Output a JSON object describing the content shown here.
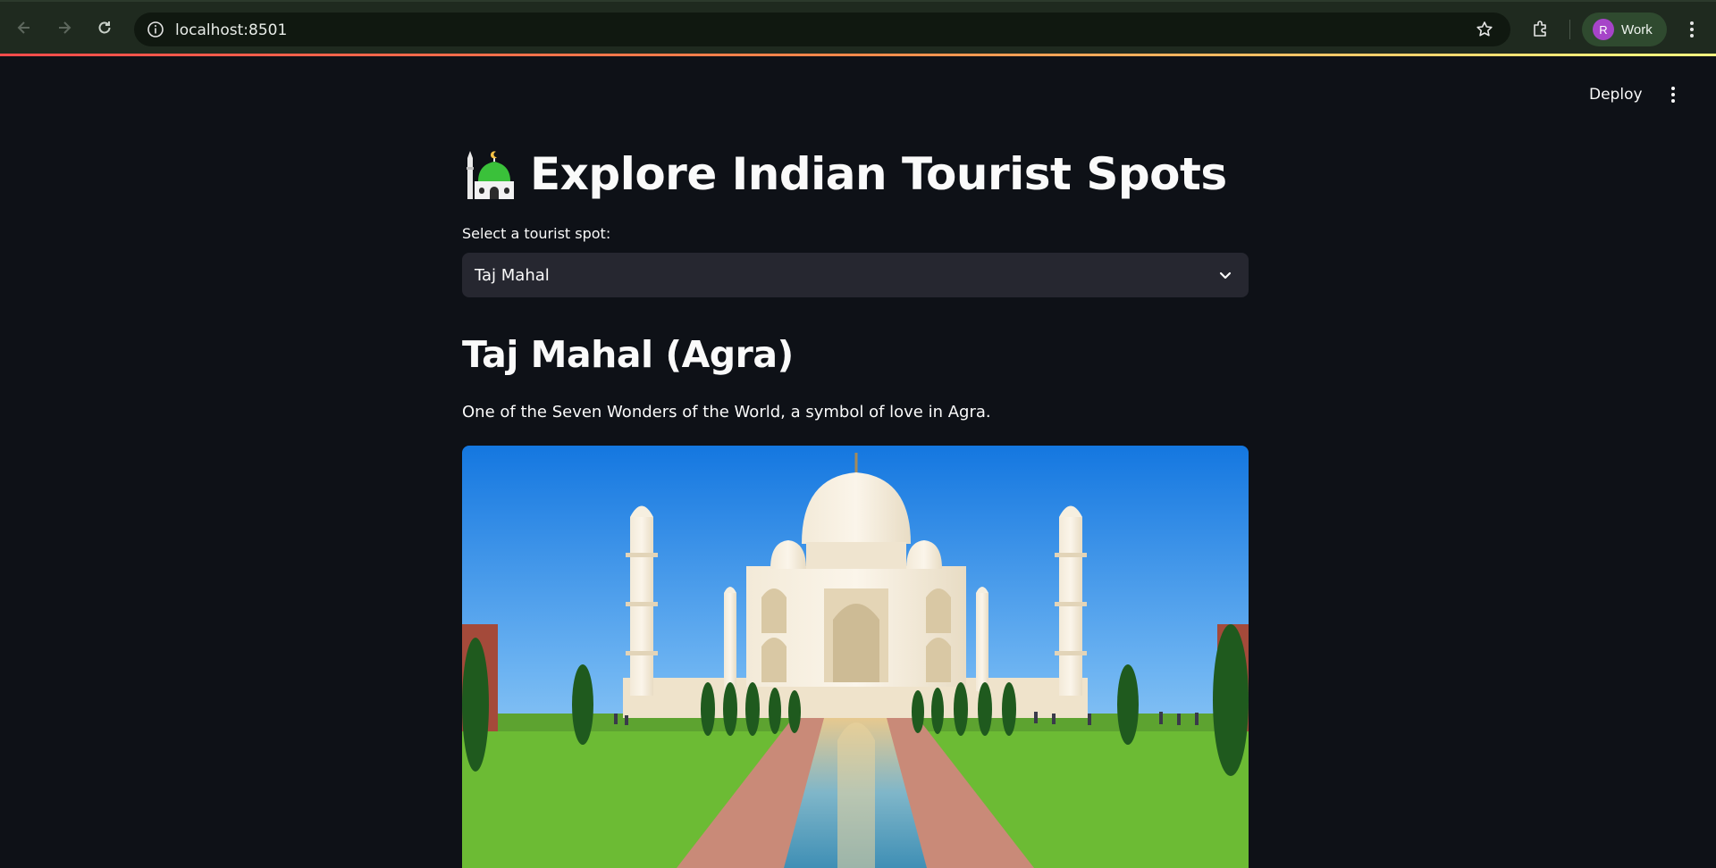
{
  "browser": {
    "url": "localhost:8501",
    "profile": {
      "initial": "R",
      "name": "Work",
      "avatar_color": "#a644c8"
    }
  },
  "app": {
    "header": {
      "deploy_label": "Deploy"
    },
    "title": "Explore Indian Tourist Spots",
    "title_icon": "mosque-icon",
    "select": {
      "label": "Select a tourist spot:",
      "selected": "Taj Mahal"
    },
    "spot": {
      "heading": "Taj Mahal (Agra)",
      "description": "One of the Seven Wonders of the World, a symbol of love in Agra.",
      "image_subject": "taj-mahal-photo"
    }
  },
  "colors": {
    "background": "#0e1117",
    "widget": "#262730",
    "accent_gradient": [
      "#ff4b4b",
      "#fffd80"
    ]
  }
}
